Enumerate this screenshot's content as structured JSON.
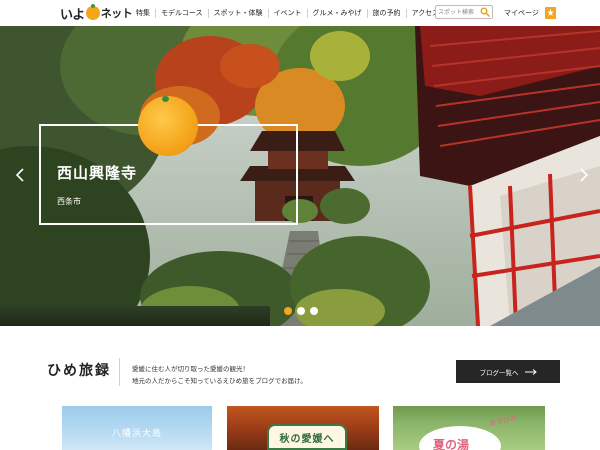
{
  "header": {
    "logo_part1": "いよ",
    "logo_part2": "ネット",
    "nav": [
      "特集",
      "モデルコース",
      "スポット・体験",
      "イベント",
      "グルメ・みやげ",
      "旅の予約",
      "アクセス"
    ],
    "search_placeholder": "スポット検索",
    "mypage_label": "マイページ"
  },
  "hero": {
    "title": "西山興隆寺",
    "location": "西条市",
    "slide_count": 3,
    "active_slide": 1
  },
  "blog": {
    "title": "ひめ旅録",
    "desc_line1": "愛媛に住む人が切り取った愛媛の観光！",
    "desc_line2": "地元の人だからこそ知っているえひめ旅をブログでお届け。",
    "button_label": "ブログ一覧へ"
  },
  "cards": [
    {
      "text": "八幡浜大島"
    },
    {
      "text": "秋の愛媛へ"
    },
    {
      "script": "あそびの",
      "text": "夏の湯"
    }
  ],
  "colors": {
    "accent": "#f4a51c",
    "button_bg": "#262626"
  }
}
